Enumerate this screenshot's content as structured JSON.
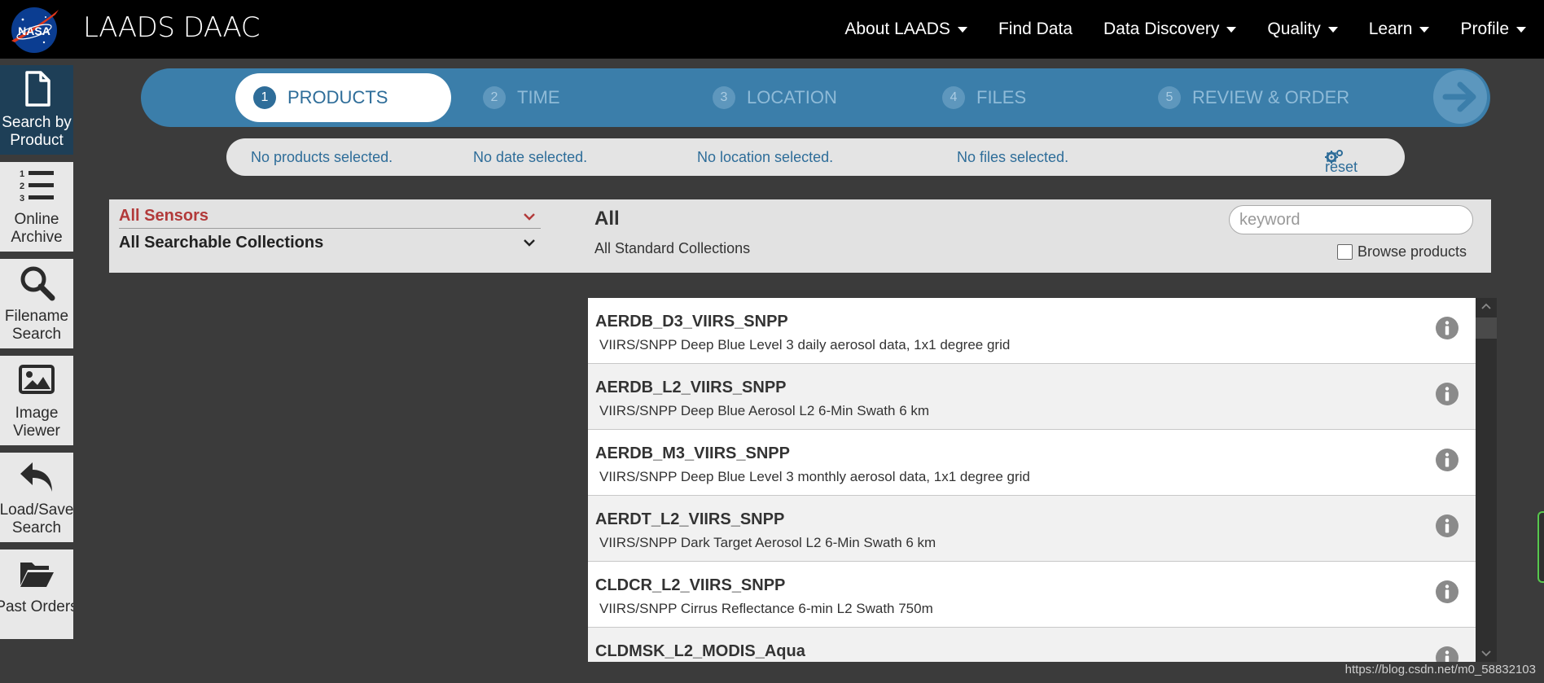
{
  "header": {
    "brand": "LAADS DAAC",
    "logo_text": "NASA",
    "nav": [
      {
        "label": "About LAADS",
        "dropdown": true
      },
      {
        "label": "Find Data",
        "dropdown": false
      },
      {
        "label": "Data Discovery",
        "dropdown": true
      },
      {
        "label": "Quality",
        "dropdown": true
      },
      {
        "label": "Learn",
        "dropdown": true
      },
      {
        "label": "Profile",
        "dropdown": true
      }
    ]
  },
  "sidebar": {
    "items": [
      {
        "line1": "Search by",
        "line2": "Product",
        "icon": "document-icon",
        "active": true
      },
      {
        "line1": "Online",
        "line2": "Archive",
        "icon": "numbered-list-icon",
        "active": false
      },
      {
        "line1": "Filename",
        "line2": "Search",
        "icon": "search-icon",
        "active": false
      },
      {
        "line1": "Image",
        "line2": "Viewer",
        "icon": "image-icon",
        "active": false
      },
      {
        "line1": "Load/Save",
        "line2": "Search",
        "icon": "reply-arrow-icon",
        "active": false
      },
      {
        "line1": "Past Orders",
        "line2": "",
        "icon": "folder-open-icon",
        "active": false
      }
    ]
  },
  "wizard": {
    "steps": [
      {
        "num": "1",
        "label": "PRODUCTS",
        "active": true
      },
      {
        "num": "2",
        "label": "TIME",
        "active": false
      },
      {
        "num": "3",
        "label": "LOCATION",
        "active": false
      },
      {
        "num": "4",
        "label": "FILES",
        "active": false
      },
      {
        "num": "5",
        "label": "REVIEW & ORDER",
        "active": false
      }
    ],
    "next_icon": "arrow-right-circle-icon"
  },
  "status": {
    "products": "No products selected.",
    "date": "No date selected.",
    "location": "No location selected.",
    "files": "No files selected.",
    "reset_label": "reset"
  },
  "filters": {
    "sensors": "All Sensors",
    "collections": "All Searchable Collections",
    "category_title": "All",
    "category_subtitle": "All Standard Collections",
    "keyword_placeholder": "keyword",
    "keyword_value": "",
    "browse_label": "Browse products",
    "browse_checked": false
  },
  "products": [
    {
      "name": "AERDB_D3_VIIRS_SNPP",
      "desc": "VIIRS/SNPP Deep Blue Level 3 daily aerosol data, 1x1 degree grid"
    },
    {
      "name": "AERDB_L2_VIIRS_SNPP",
      "desc": "VIIRS/SNPP Deep Blue Aerosol L2 6-Min Swath 6 km"
    },
    {
      "name": "AERDB_M3_VIIRS_SNPP",
      "desc": "VIIRS/SNPP Deep Blue Level 3 monthly aerosol data, 1x1 degree grid"
    },
    {
      "name": "AERDT_L2_VIIRS_SNPP",
      "desc": "VIIRS/SNPP Dark Target Aerosol L2 6-Min Swath 6 km"
    },
    {
      "name": "CLDCR_L2_VIIRS_SNPP",
      "desc": "VIIRS/SNPP Cirrus Reflectance 6-min L2 Swath 750m"
    },
    {
      "name": "CLDMSK_L2_MODIS_Aqua",
      "desc": ""
    }
  ],
  "watermark": "https://blog.csdn.net/m0_58832103",
  "colors": {
    "accent": "#3b7eaa",
    "active_step_text": "#2e6d99",
    "sensor_red": "#b23a3a",
    "sidebar_active": "#1e3f57"
  }
}
